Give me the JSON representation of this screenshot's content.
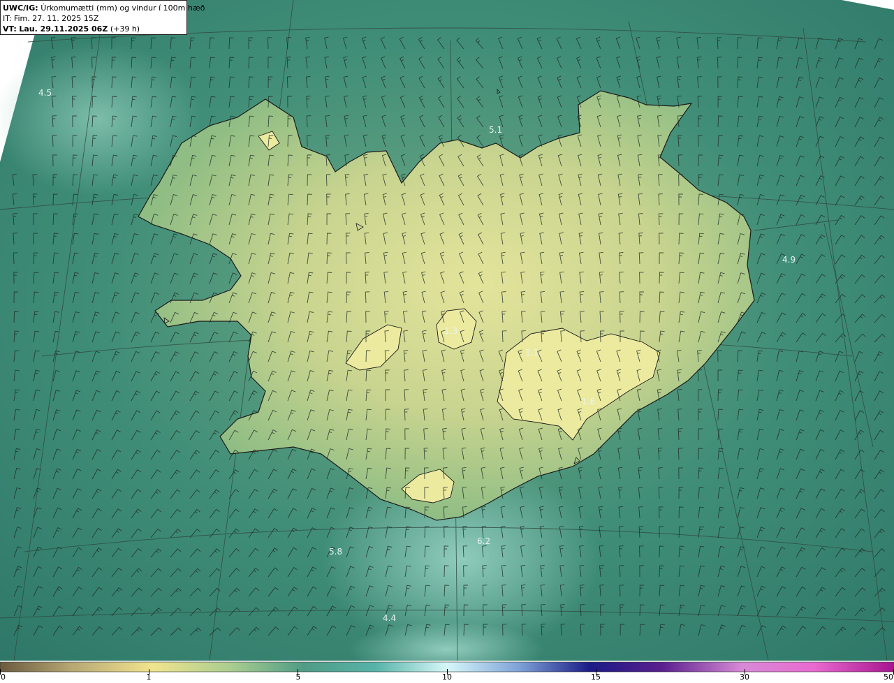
{
  "header": {
    "model": "UWC/IG:",
    "title": "Úrkomumætti (mm) og vindur í 100m hæð",
    "init_time": "IT: Fim. 27. 11. 2025 15Z",
    "valid_prefix": "VT:",
    "valid_time": "Lau. 29.11.2025 06Z",
    "lead": "(+39 h)"
  },
  "map_labels": [
    {
      "id": "lbl-nw",
      "text": "4.5"
    },
    {
      "id": "lbl-n",
      "text": "5.1"
    },
    {
      "id": "lbl-e",
      "text": "4.9"
    },
    {
      "id": "lbl-s",
      "text": "5.8"
    },
    {
      "id": "lbl-se",
      "text": "6.2"
    },
    {
      "id": "lbl-ss",
      "text": "4.4"
    },
    {
      "id": "lbl-hofs",
      "text": "1.3"
    },
    {
      "id": "lbl-vatna",
      "text": "1.1"
    },
    {
      "id": "lbl-vatna2",
      "text": "1.6"
    }
  ],
  "colorbar": {
    "ticks": [
      "0",
      "1",
      "5",
      "10",
      "15",
      "30",
      "50"
    ],
    "stops": [
      {
        "offset": 0.0,
        "color": "#6b5a3e"
      },
      {
        "offset": 0.08,
        "color": "#b6a774"
      },
      {
        "offset": 0.17,
        "color": "#f1e48e"
      },
      {
        "offset": 0.26,
        "color": "#a8cc8f"
      },
      {
        "offset": 0.34,
        "color": "#4f9c86"
      },
      {
        "offset": 0.42,
        "color": "#57b3a8"
      },
      {
        "offset": 0.5,
        "color": "#d6f7f8"
      },
      {
        "offset": 0.58,
        "color": "#7fa3d8"
      },
      {
        "offset": 0.66,
        "color": "#1b1b86"
      },
      {
        "offset": 0.74,
        "color": "#5a1f8e"
      },
      {
        "offset": 0.83,
        "color": "#d78ad6"
      },
      {
        "offset": 0.91,
        "color": "#e96ad0"
      },
      {
        "offset": 1.0,
        "color": "#a6158f"
      }
    ]
  },
  "colors": {
    "ocean_dark": "#2f7c6b",
    "ocean_mid": "#4a9a80",
    "land_low": "#a9c88a",
    "land_high": "#e3e39a",
    "coast": "#1a1a1a",
    "barb": "#1e2a24"
  }
}
